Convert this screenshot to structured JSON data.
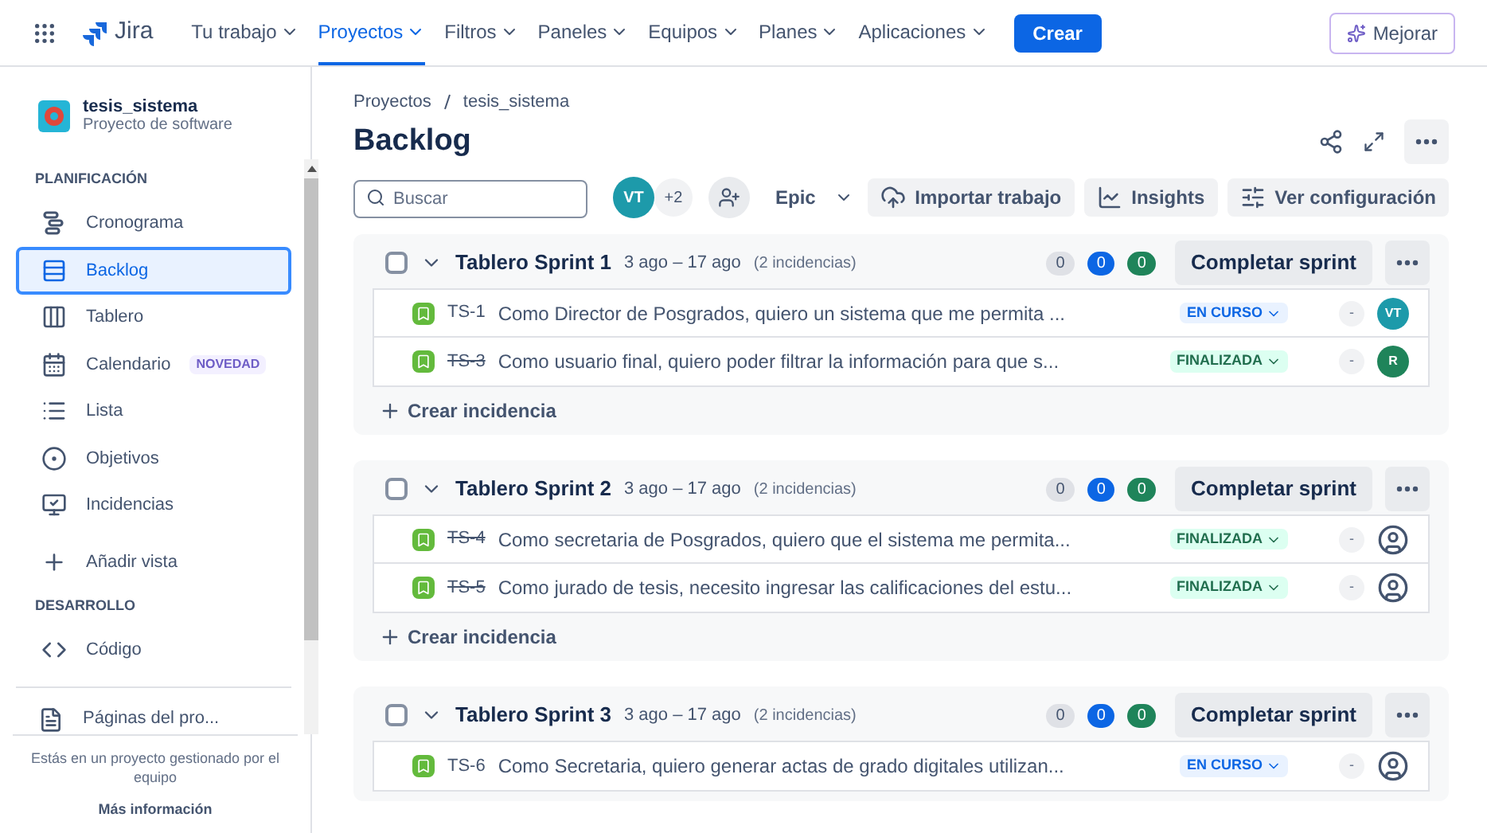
{
  "topbar": {
    "product": "Jira",
    "menus": [
      {
        "label": "Tu trabajo",
        "selected": false
      },
      {
        "label": "Proyectos",
        "selected": true
      },
      {
        "label": "Filtros",
        "selected": false
      },
      {
        "label": "Paneles",
        "selected": false
      },
      {
        "label": "Equipos",
        "selected": false
      },
      {
        "label": "Planes",
        "selected": false
      },
      {
        "label": "Aplicaciones",
        "selected": false
      }
    ],
    "create_button": "Crear",
    "upgrade_button": "Mejorar"
  },
  "sidebar": {
    "project": {
      "name": "tesis_sistema",
      "type": "Proyecto de software"
    },
    "sections": [
      {
        "title": "PLANIFICACIÓN",
        "items": [
          {
            "kind": "timeline",
            "label": "Cronograma",
            "selected": false
          },
          {
            "kind": "backlog",
            "label": "Backlog",
            "selected": true
          },
          {
            "kind": "board",
            "label": "Tablero",
            "selected": false
          },
          {
            "kind": "calendar",
            "label": "Calendario",
            "badge": "NOVEDAD",
            "selected": false
          },
          {
            "kind": "list",
            "label": "Lista",
            "selected": false
          },
          {
            "kind": "goals",
            "label": "Objetivos",
            "selected": false
          },
          {
            "kind": "issues",
            "label": "Incidencias",
            "selected": false
          },
          {
            "kind": "add",
            "label": "Añadir vista",
            "selected": false
          }
        ]
      },
      {
        "title": "DESARROLLO",
        "items": [
          {
            "kind": "code",
            "label": "Código",
            "selected": false
          }
        ]
      }
    ],
    "pages_item": "Páginas del pro...",
    "footer_text": "Estás en un proyecto gestionado por el equipo",
    "footer_link": "Más información"
  },
  "breadcrumbs": [
    "Proyectos",
    "tesis_sistema"
  ],
  "page_title": "Backlog",
  "toolbar": {
    "search": {
      "placeholder": "Buscar"
    },
    "avatar": "VT",
    "extra_count": "+2",
    "epic_filter": "Epic",
    "buttons": [
      {
        "kind": "import",
        "label": "Importar trabajo"
      },
      {
        "kind": "insights",
        "label": "Insights"
      },
      {
        "kind": "settings",
        "label": "Ver configuración"
      }
    ]
  },
  "sprints": [
    {
      "name": "Tablero Sprint 1",
      "checked": false,
      "dates": "3 ago – 17 ago",
      "count": "(2 incidencias)",
      "todo": "0",
      "in_progress": "0",
      "done": "0",
      "complete_button": "Completar sprint",
      "create_issue": "Crear incidencia",
      "issues": [
        {
          "key": "TS-1",
          "summary": "Como Director de Posgrados, quiero un sistema que me permita ...",
          "status": "EN CURSO",
          "kind": "in_progress",
          "estimate": "-",
          "assignee": {
            "initials": "VT",
            "color": "#1d9aaa"
          }
        },
        {
          "key": "TS-3",
          "summary": "Como usuario final, quiero poder filtrar la información para que s...",
          "status": "FINALIZADA",
          "kind": "done",
          "estimate": "-",
          "assignee": {
            "initials": "R",
            "color": "#1f845a"
          }
        }
      ]
    },
    {
      "name": "Tablero Sprint 2",
      "checked": false,
      "dates": "3 ago – 17 ago",
      "count": "(2 incidencias)",
      "todo": "0",
      "in_progress": "0",
      "done": "0",
      "complete_button": "Completar sprint",
      "create_issue": "Crear incidencia",
      "issues": [
        {
          "key": "TS-4",
          "summary": "Como secretaria de Posgrados, quiero que el sistema me permita...",
          "status": "FINALIZADA",
          "kind": "done",
          "estimate": "-"
        },
        {
          "key": "TS-5",
          "summary": "Como jurado de tesis, necesito ingresar las calificaciones del estu...",
          "status": "FINALIZADA",
          "kind": "done",
          "estimate": "-"
        }
      ]
    },
    {
      "name": "Tablero Sprint 3",
      "checked": false,
      "dates": "3 ago – 17 ago",
      "count": "(2 incidencias)",
      "todo": "0",
      "in_progress": "0",
      "done": "0",
      "complete_button": "Completar sprint",
      "issues": [
        {
          "key": "TS-6",
          "summary": "Como Secretaria, quiero generar actas de grado digitales utilizan...",
          "status": "EN CURSO",
          "kind": "in_progress",
          "estimate": "-"
        }
      ]
    }
  ]
}
